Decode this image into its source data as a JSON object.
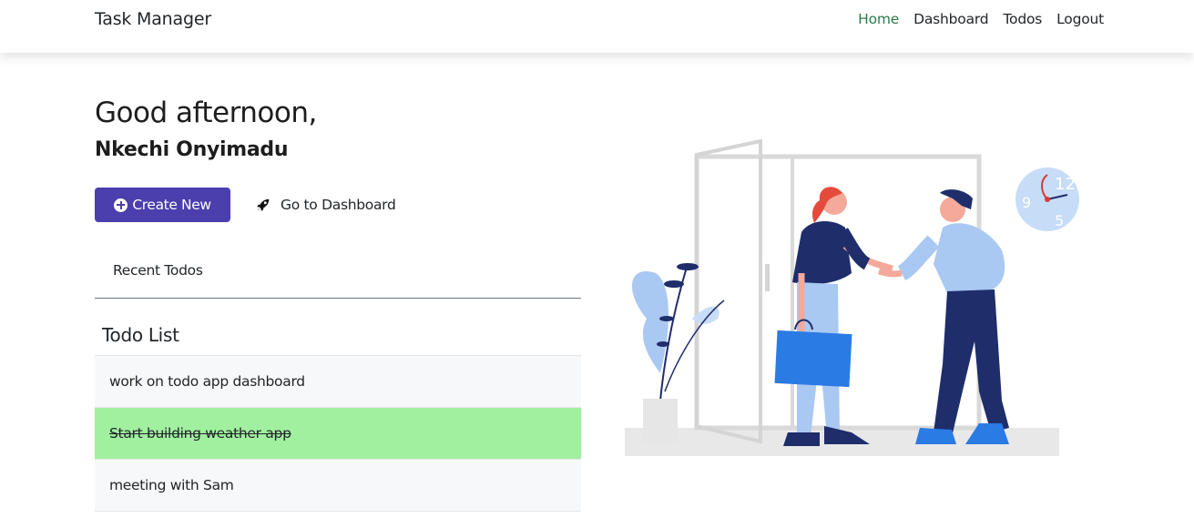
{
  "nav": {
    "brand": "Task Manager",
    "links": [
      "Home",
      "Dashboard",
      "Todos",
      "Logout"
    ],
    "active": "Home"
  },
  "hero": {
    "greeting": "Good afternoon,",
    "username": "Nkechi Onyimadu",
    "create_button": "Create New",
    "dashboard_link": "Go to Dashboard"
  },
  "tabs": {
    "recent": "Recent Todos"
  },
  "todos": {
    "title": "Todo List",
    "items": [
      {
        "text": "work on todo app dashboard",
        "done": false
      },
      {
        "text": "Start building weather app",
        "done": true
      },
      {
        "text": "meeting with Sam",
        "done": false
      }
    ]
  },
  "colors": {
    "primary": "#4a3fad",
    "active_nav": "#2f7a4a",
    "done_row": "#a1f0a0"
  },
  "icons": {
    "create": "plus-circle-icon",
    "dashboard": "rocket-icon"
  }
}
